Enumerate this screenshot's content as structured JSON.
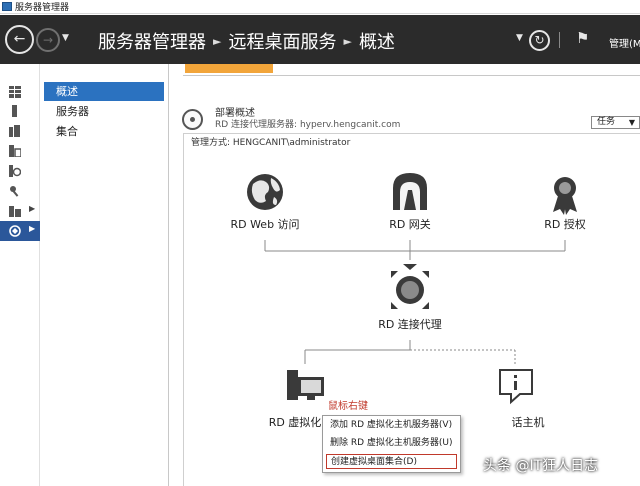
{
  "window": {
    "title": "服务器管理器"
  },
  "header": {
    "breadcrumb": [
      "服务器管理器",
      "远程桌面服务",
      "概述"
    ],
    "manage_label": "管理(M"
  },
  "rail": {
    "items": [
      {
        "icon": "dashboard-icon"
      },
      {
        "icon": "local-server-icon"
      },
      {
        "icon": "all-servers-icon"
      },
      {
        "icon": "file-storage-icon"
      },
      {
        "icon": "iis-icon"
      },
      {
        "icon": "tools-icon"
      },
      {
        "icon": "server-roles-icon",
        "expandable": true
      },
      {
        "icon": "remote-desktop-icon",
        "expandable": true,
        "active": true
      }
    ]
  },
  "sidebar": {
    "items": [
      {
        "label": "概述",
        "active": true
      },
      {
        "label": "服务器",
        "active": false
      },
      {
        "label": "集合",
        "active": false
      }
    ]
  },
  "deployment": {
    "title": "部署概述",
    "broker_line": "RD 连接代理服务器: hyperv.hengcanit.com",
    "task_button": "任务",
    "managed_as": "管理方式: HENGCANIT\\administrator"
  },
  "nodes": {
    "web_access": "RD Web 访问",
    "gateway": "RD 网关",
    "licensing": "RD 授权",
    "broker": "RD 连接代理",
    "virtualization_host": "RD 虚拟化",
    "session_host": "话主机"
  },
  "annotation": "鼠标右键",
  "context_menu": {
    "items": [
      {
        "label": "添加 RD 虚拟化主机服务器(V)",
        "highlighted": false
      },
      {
        "label": "删除 RD 虚拟化主机服务器(U)",
        "highlighted": false
      },
      {
        "label": "创建虚拟桌面集合(D)",
        "highlighted": true
      }
    ]
  },
  "watermark": "头条 @IT狂人日志",
  "colors": {
    "header_bg": "#2b2b2b",
    "selected": "#2b72c0",
    "annotation": "#c0392b"
  }
}
